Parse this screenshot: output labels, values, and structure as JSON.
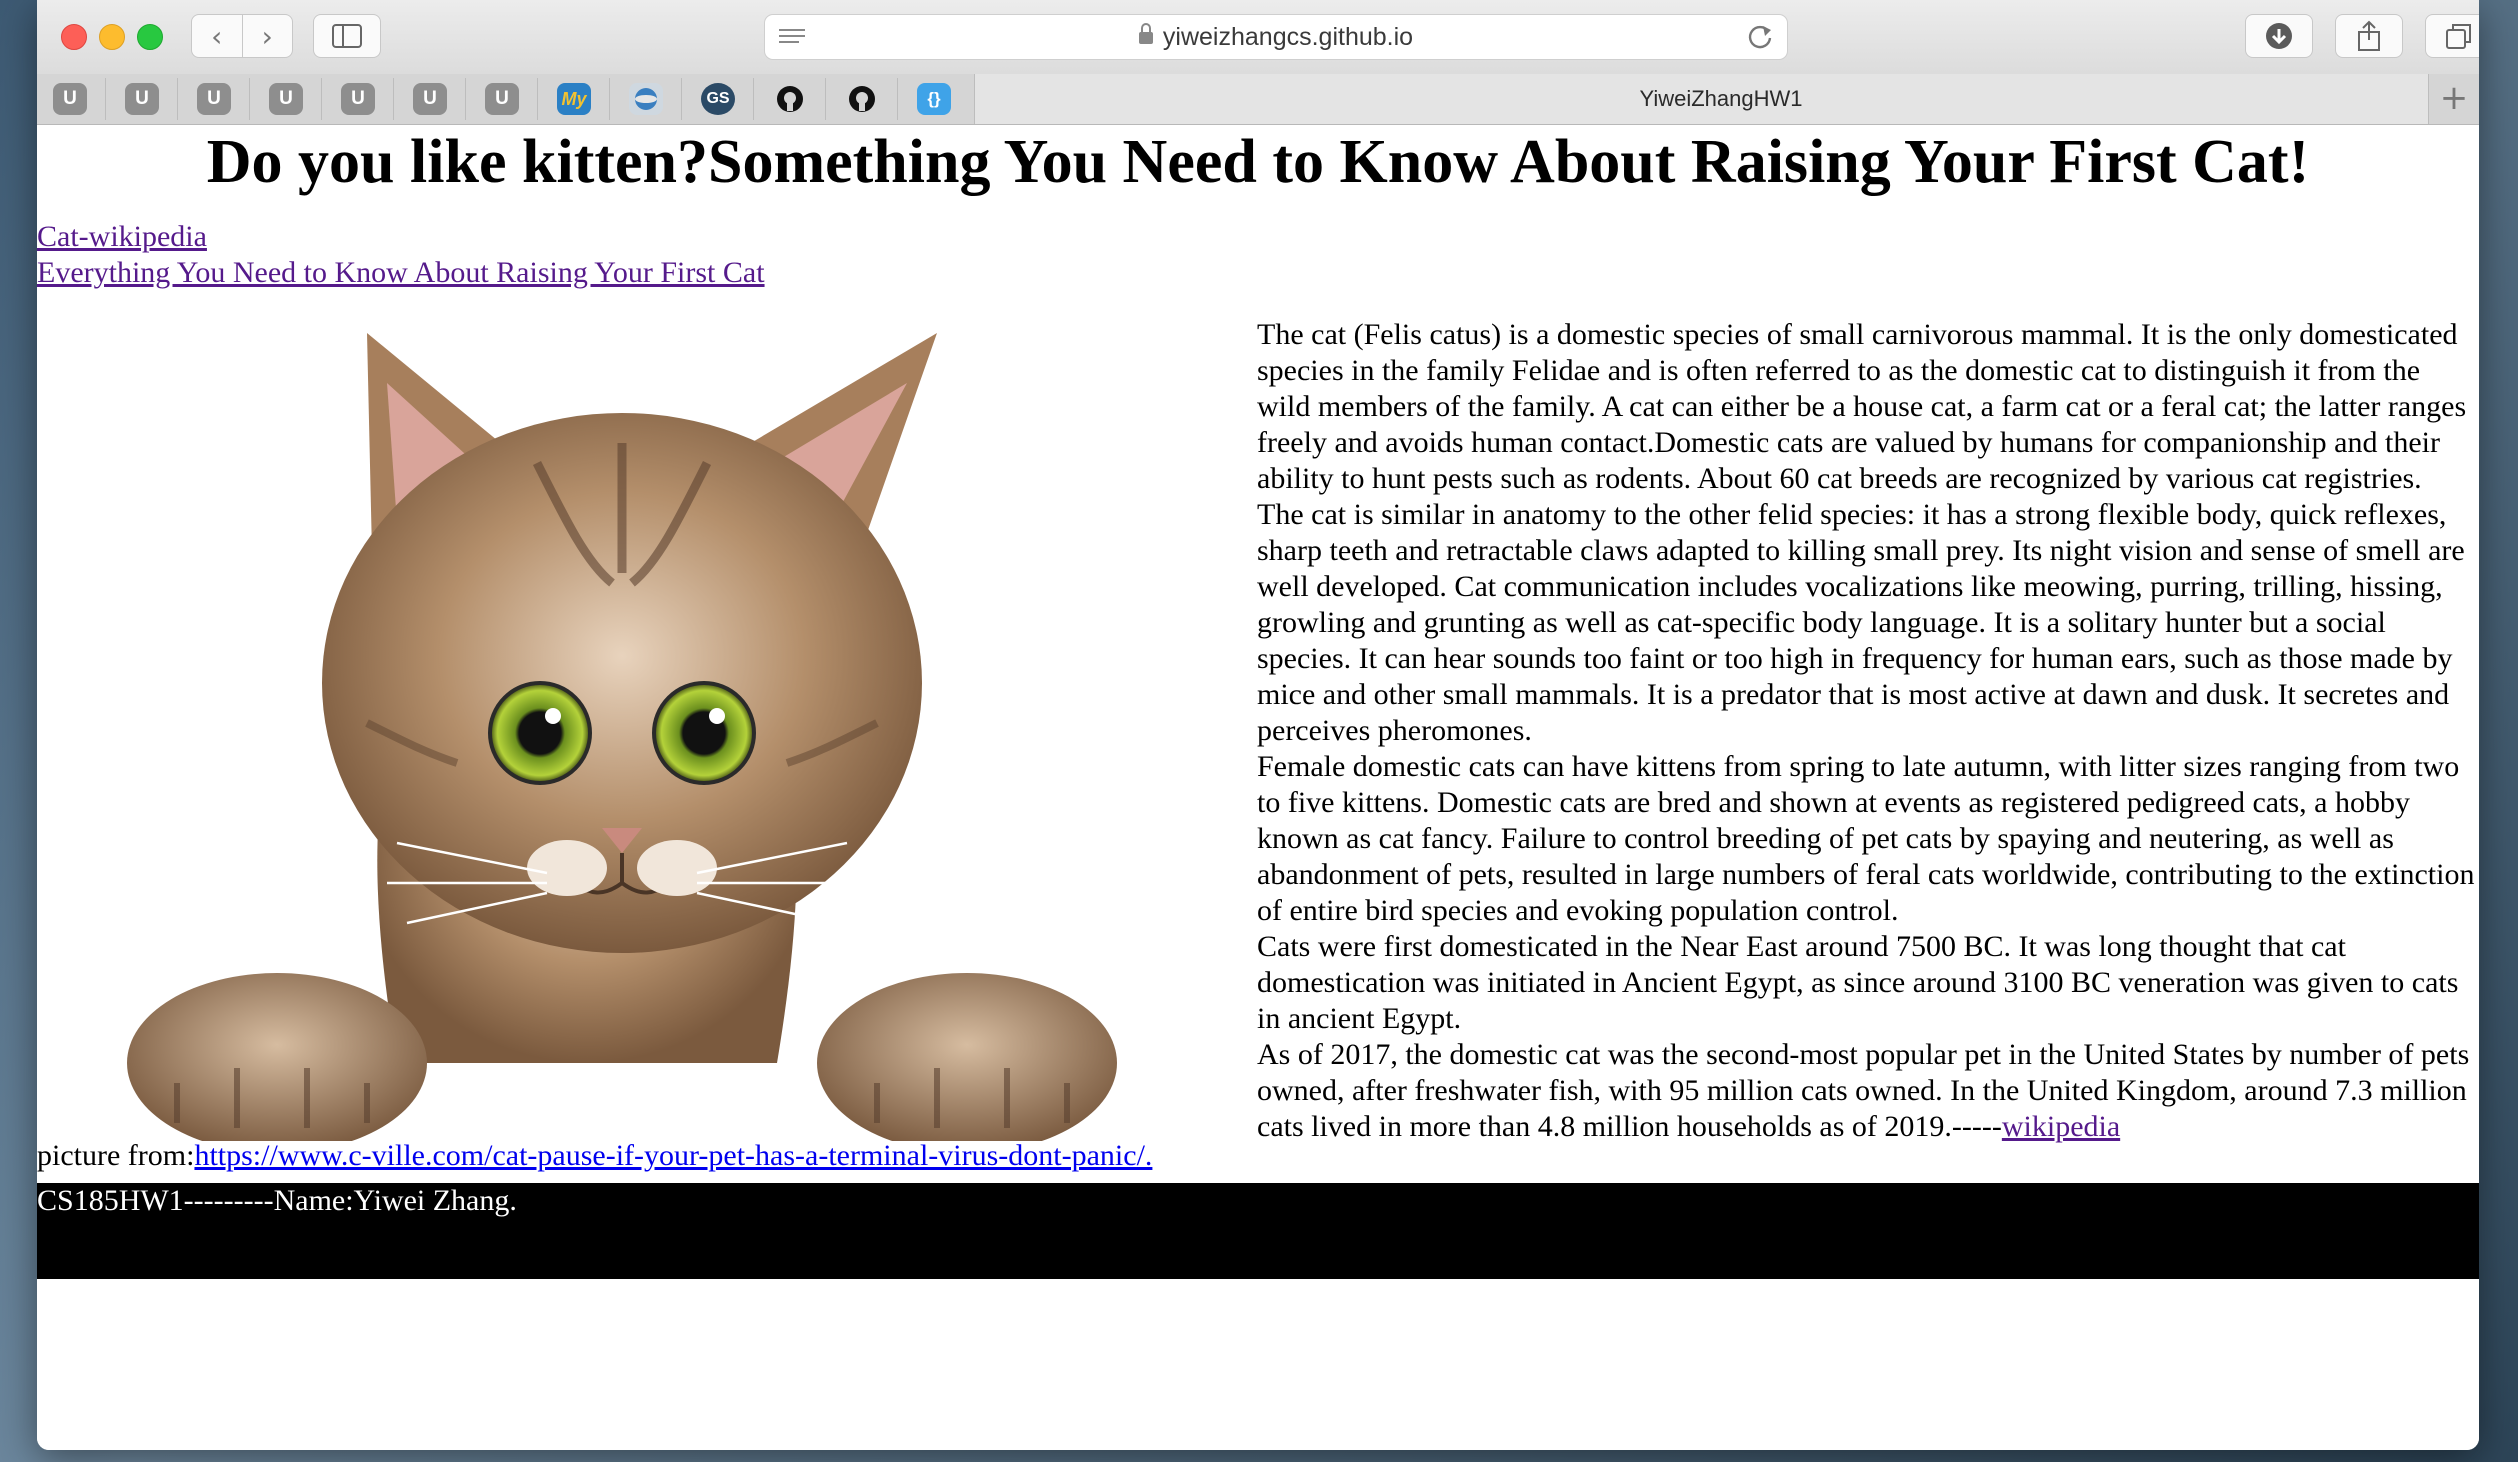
{
  "browser": {
    "url": "yiweizhangcs.github.io",
    "tab_title": "YiweiZhangHW1",
    "back_glyph": "‹",
    "forward_glyph": "›",
    "new_tab_glyph": "+",
    "bookmarks": [
      {
        "label": "U",
        "icon": "u-bookmark-icon"
      },
      {
        "label": "U",
        "icon": "u-bookmark-icon"
      },
      {
        "label": "U",
        "icon": "u-bookmark-icon"
      },
      {
        "label": "U",
        "icon": "u-bookmark-icon"
      },
      {
        "label": "U",
        "icon": "u-bookmark-icon"
      },
      {
        "label": "U",
        "icon": "u-bookmark-icon"
      },
      {
        "label": "U",
        "icon": "u-bookmark-icon"
      },
      {
        "label": "My",
        "icon": "my-bookmark-icon"
      },
      {
        "label": "",
        "icon": "globe-bookmark-icon"
      },
      {
        "label": "GS",
        "icon": "gs-bookmark-icon"
      },
      {
        "label": "",
        "icon": "github-icon"
      },
      {
        "label": "",
        "icon": "github-icon"
      },
      {
        "label": "{}",
        "icon": "code-bookmark-icon"
      }
    ]
  },
  "page": {
    "title": "Do you like kitten?Something You Need to Know About Raising Your First Cat!",
    "links": [
      "Cat-wikipedia",
      "Everything You Need to Know About Raising Your First Cat"
    ],
    "image_alt": "cat",
    "credit_prefix": "picture from:",
    "credit_link": "https://www.c-ville.com/cat-pause-if-your-pet-has-a-terminal-virus-dont-panic/.",
    "paragraphs": [
      "The cat (Felis catus) is a domestic species of small carnivorous mammal. It is the only domesticated species in the family Felidae and is often referred to as the domestic cat to distinguish it from the wild members of the family. A cat can either be a house cat, a farm cat or a feral cat; the latter ranges freely and avoids human contact.Domestic cats are valued by humans for companionship and their ability to hunt pests such as rodents. About 60 cat breeds are recognized by various cat registries.",
      "The cat is similar in anatomy to the other felid species: it has a strong flexible body, quick reflexes, sharp teeth and retractable claws adapted to killing small prey. Its night vision and sense of smell are well developed. Cat communication includes vocalizations like meowing, purring, trilling, hissing, growling and grunting as well as cat-specific body language. It is a solitary hunter but a social species. It can hear sounds too faint or too high in frequency for human ears, such as those made by mice and other small mammals. It is a predator that is most active at dawn and dusk. It secretes and perceives pheromones.",
      "Female domestic cats can have kittens from spring to late autumn, with litter sizes ranging from two to five kittens. Domestic cats are bred and shown at events as registered pedigreed cats, a hobby known as cat fancy. Failure to control breeding of pet cats by spaying and neutering, as well as abandonment of pets, resulted in large numbers of feral cats worldwide, contributing to the extinction of entire bird species and evoking population control.",
      "Cats were first domesticated in the Near East around 7500 BC. It was long thought that cat domestication was initiated in Ancient Egypt, as since around 3100 BC veneration was given to cats in ancient Egypt."
    ],
    "last_paragraph": "As of 2017, the domestic cat was the second-most popular pet in the United States by number of pets owned, after freshwater fish, with 95 million cats owned. In the United Kingdom, around 7.3 million cats lived in more than 4.8 million households as of 2019.-----",
    "last_link": "wikipedia",
    "footer": "CS185HW1---------Name:Yiwei Zhang."
  }
}
